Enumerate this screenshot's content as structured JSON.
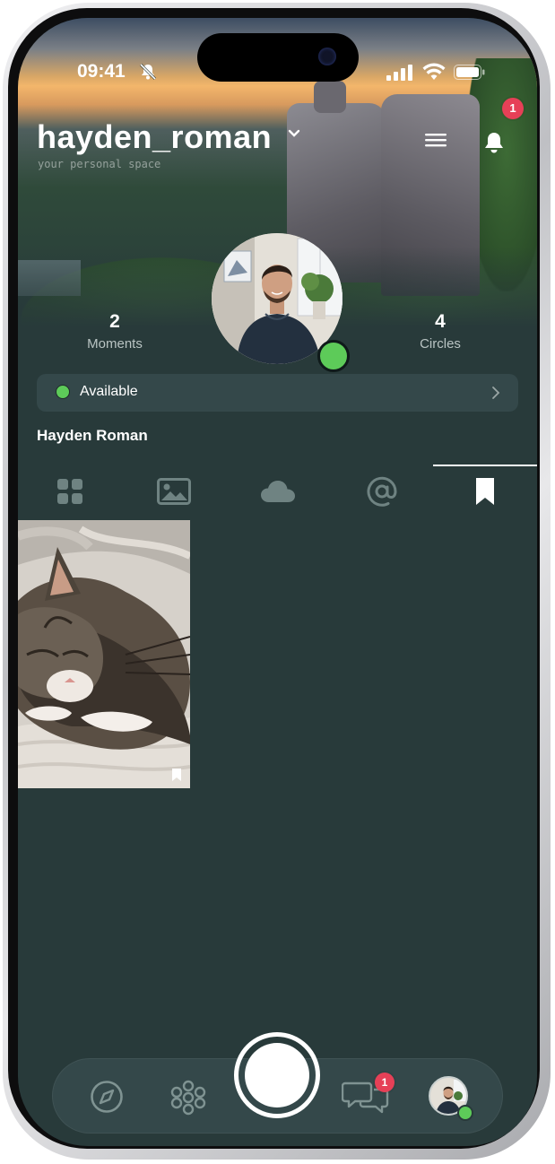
{
  "status_bar": {
    "time": "09:41"
  },
  "header": {
    "username": "hayden_roman",
    "tagline": "your personal space",
    "notification_count": "1"
  },
  "stats": {
    "moments_count": "2",
    "moments_label": "Moments",
    "circles_count": "4",
    "circles_label": "Circles"
  },
  "availability": {
    "label": "Available",
    "color": "#5dcb59"
  },
  "profile": {
    "full_name": "Hayden Roman"
  },
  "tabs": [
    {
      "icon": "grid-icon"
    },
    {
      "icon": "image-icon"
    },
    {
      "icon": "cloud-icon"
    },
    {
      "icon": "at-icon"
    },
    {
      "icon": "bookmark-icon",
      "active": true
    }
  ],
  "saved_items": [
    {
      "icon": "bookmark-icon"
    }
  ],
  "bottom_nav": {
    "messages_badge": "1"
  },
  "colors": {
    "background": "#283a3a",
    "badge": "#e64057",
    "accent_green": "#5dcb59"
  }
}
